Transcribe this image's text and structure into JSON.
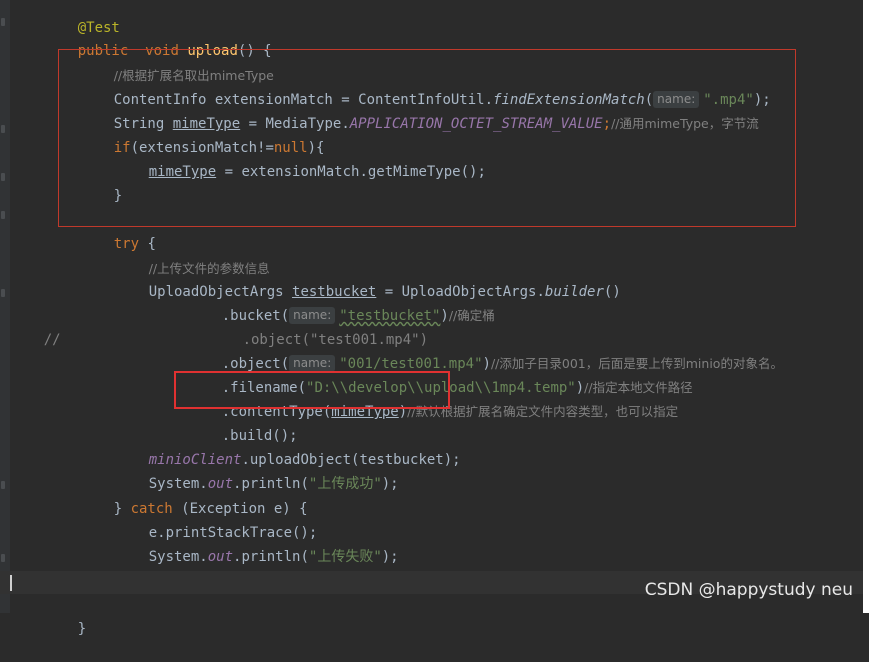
{
  "editor": {
    "lines": {
      "l0_annotation": "@Test",
      "l1_kw_public": "public",
      "l1_kw_void": "void",
      "l1_method": "upload",
      "l1_rest": "() {",
      "l2_comment": "//根据扩展名取出mimeType",
      "l3_a": "ContentInfo extensionMatch = ContentInfoUtil.",
      "l3_fn": "findExtensionMatch",
      "l3_paren": "(",
      "l3_hint": "name:",
      "l3_str": "\".mp4\"",
      "l3_end": ");",
      "l4_a": "String ",
      "l4_var": "mimeType",
      "l4_b": " = MediaType.",
      "l4_const": "APPLICATION_OCTET_STREAM_VALUE",
      "l4_semi": ";",
      "l4_comment": "//通用mimeType，字节流",
      "l5_kw": "if",
      "l5_a": "(extensionMatch!=",
      "l5_null": "null",
      "l5_b": "){",
      "l6_var": "mimeType",
      "l6_rest": " = extensionMatch.getMimeType();",
      "l7": "}",
      "l9_kw": "try",
      "l9_rest": " {",
      "l10_comment": "//上传文件的参数信息",
      "l11_a": "UploadObjectArgs ",
      "l11_var": "testbucket",
      "l11_b": " = UploadObjectArgs.",
      "l11_fn": "builder",
      "l11_c": "()",
      "l12_a": ".bucket(",
      "l12_hint": "name:",
      "l12_str": "\"testbucket\"",
      "l12_b": ")",
      "l12_comment": "//确定桶",
      "l13_prefix": "//",
      "l13_text": ".object(\"test001.mp4\")",
      "l14_a": ".object(",
      "l14_hint": "name:",
      "l14_str": "\"001/test001.mp4\"",
      "l14_b": ")",
      "l14_comment": "//添加子目录001，后面是要上传到minio的对象名。",
      "l15_a": ".filename(",
      "l15_str": "\"D:\\\\develop\\\\upload\\\\1mp4.temp\"",
      "l15_b": ")",
      "l15_comment": "//指定本地文件路径",
      "l16_a": ".contentType(",
      "l16_var": "mimeType",
      "l16_b": ")",
      "l16_comment": "//默认根据扩展名确定文件内容类型，也可以指定",
      "l17": ".build();",
      "l18_a": "minioClient",
      "l18_b": ".uploadObject(testbucket);",
      "l19_a": "System.",
      "l19_out": "out",
      "l19_b": ".println(",
      "l19_str": "\"上传成功\"",
      "l19_c": ");",
      "l20_a": "} ",
      "l20_kw": "catch",
      "l20_b": " (Exception e) {",
      "l21": "e.printStackTrace();",
      "l22_a": "System.",
      "l22_out": "out",
      "l22_b": ".println(",
      "l22_str": "\"上传失败\"",
      "l22_c": ");",
      "l23": "}",
      "l25": "}"
    }
  },
  "watermark": "CSDN @happystudy neu",
  "colors": {
    "background": "#2b2b2b",
    "keyword": "#cc7832",
    "method": "#ffc66d",
    "string": "#6a8759",
    "comment": "#808080",
    "constant": "#9876aa",
    "highlight_box": "#e03131"
  }
}
